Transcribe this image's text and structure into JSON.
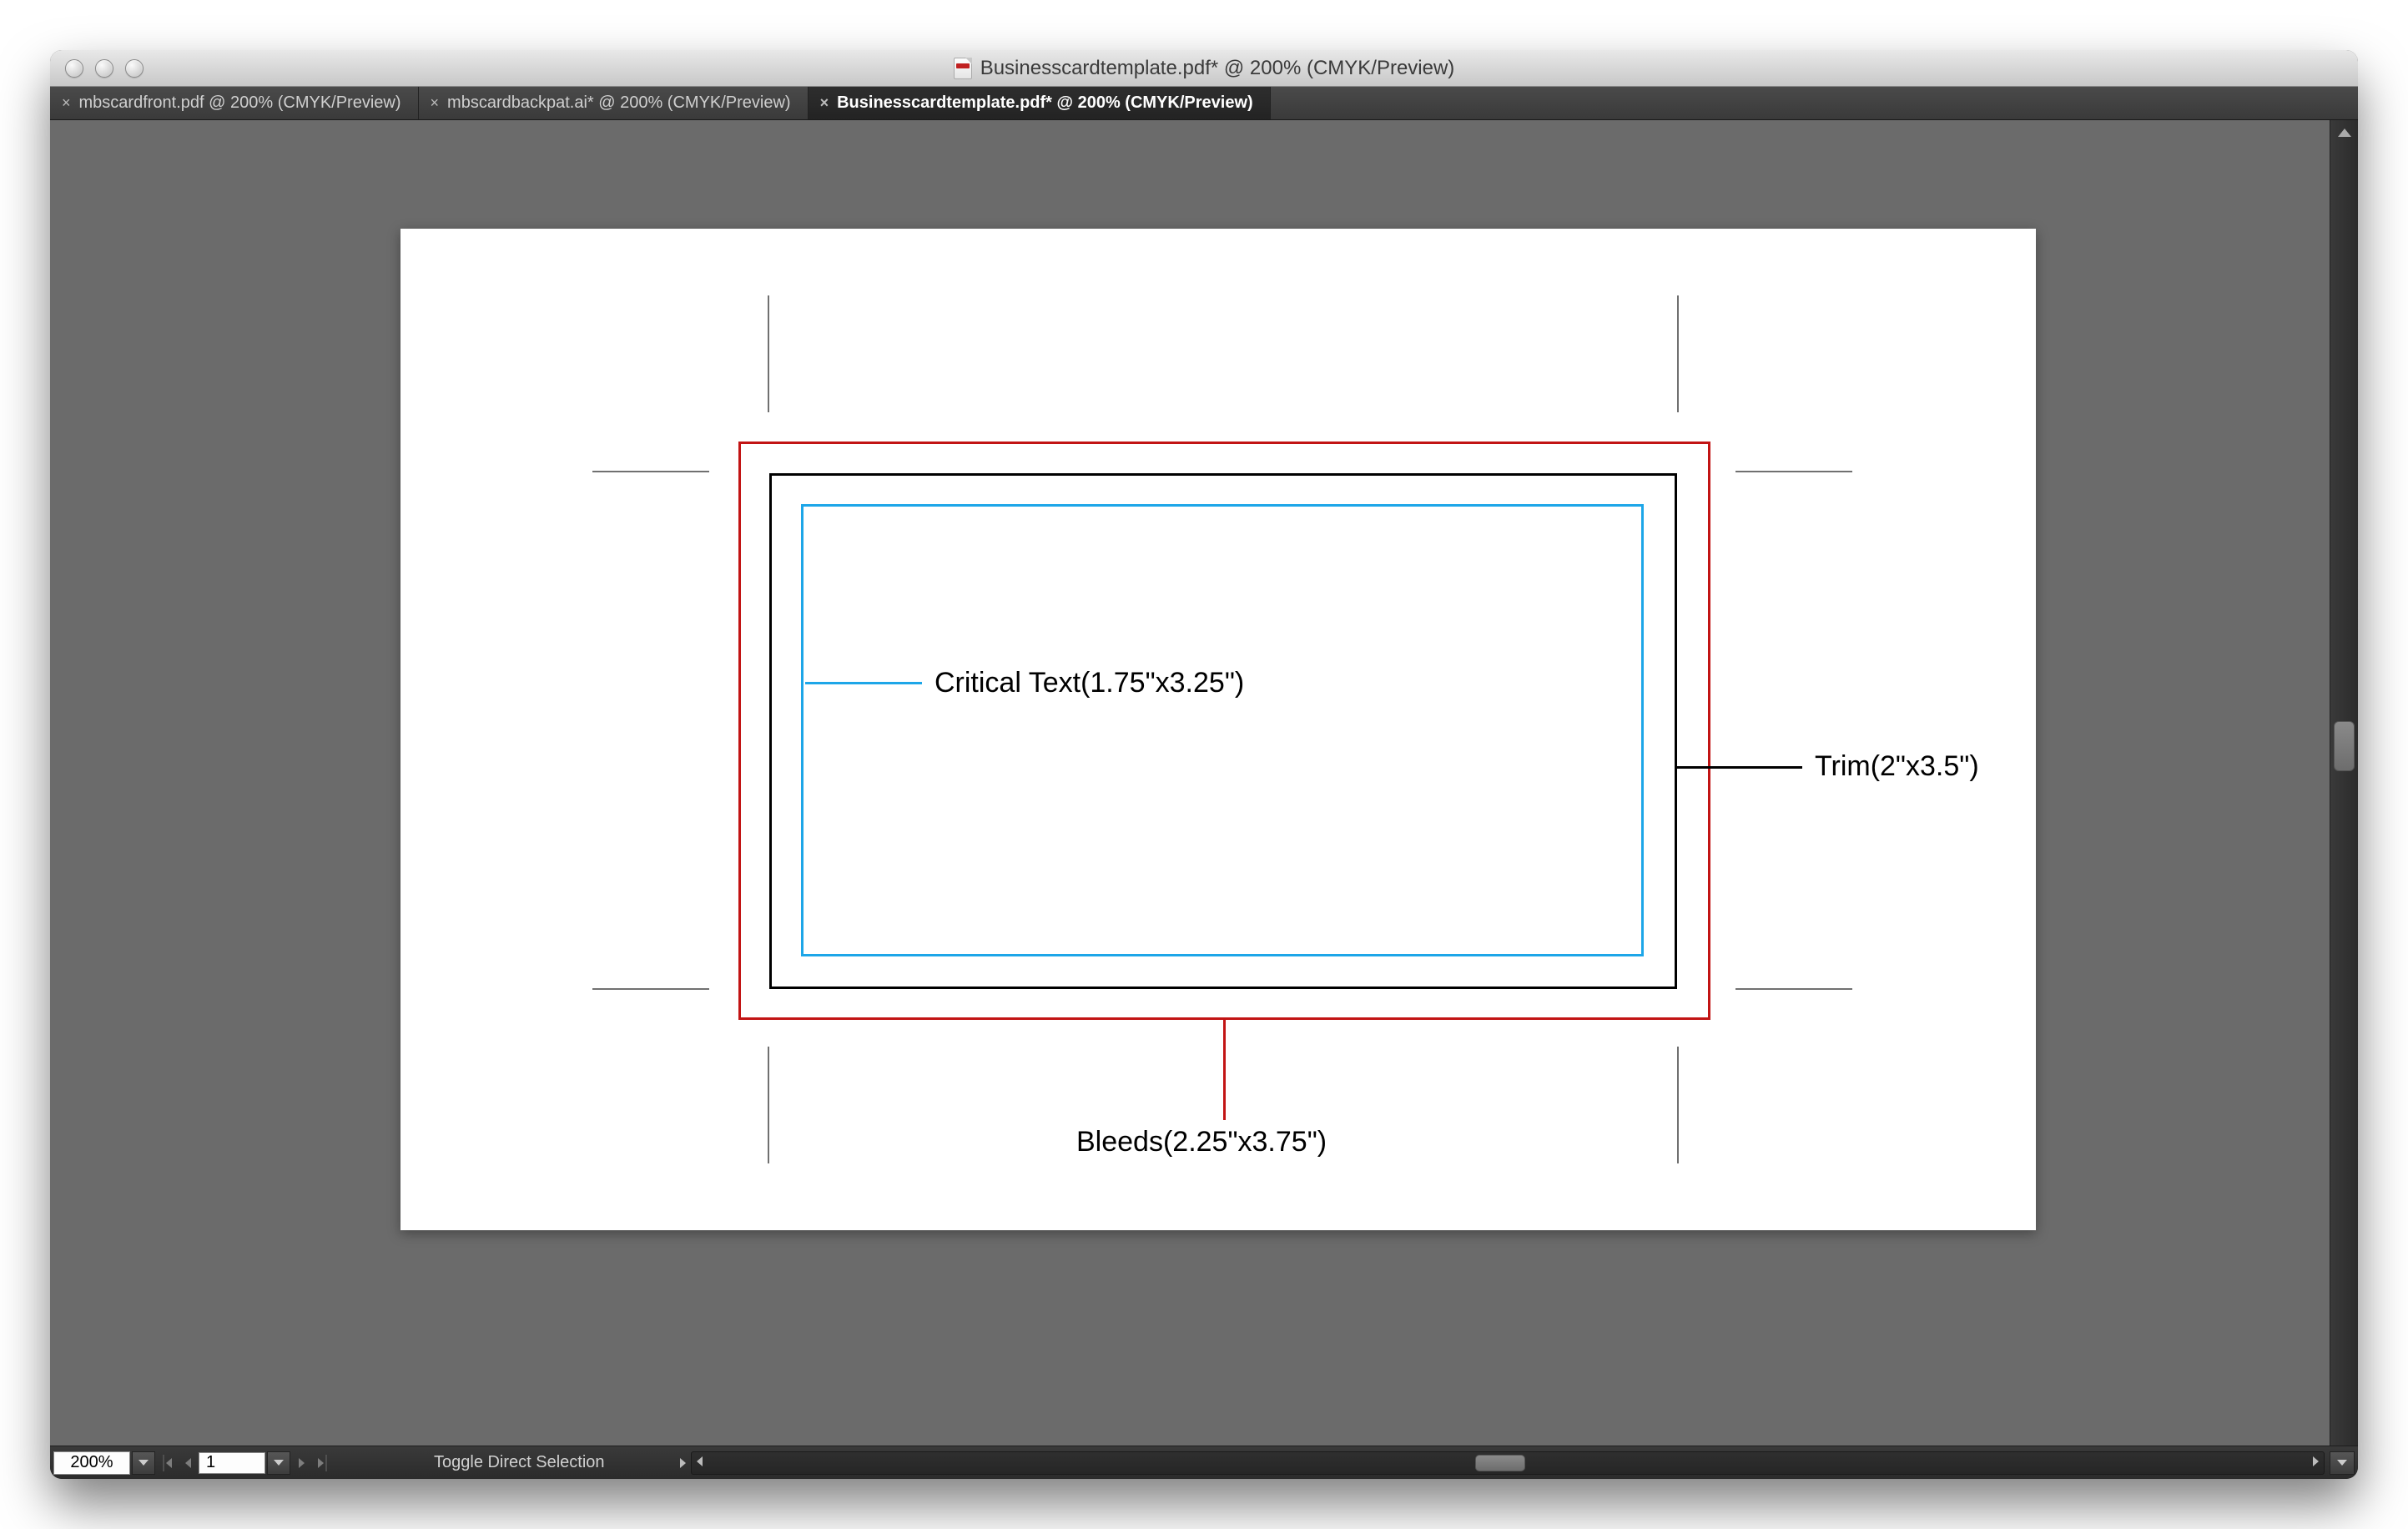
{
  "window": {
    "title": "Businesscardtemplate.pdf* @ 200% (CMYK/Preview)"
  },
  "tabs": [
    {
      "label": "mbscardfront.pdf @ 200% (CMYK/Preview)",
      "active": false
    },
    {
      "label": "mbscardbackpat.ai* @ 200% (CMYK/Preview)",
      "active": false
    },
    {
      "label": "Businesscardtemplate.pdf* @ 200% (CMYK/Preview)",
      "active": true
    }
  ],
  "artboard": {
    "labels": {
      "critical": "Critical Text(1.75\"x3.25\")",
      "trim": "Trim(2\"x3.5\")",
      "bleed": "Bleeds(2.25\"x3.75\")"
    },
    "colors": {
      "bleed": "#c21414",
      "trim": "#000000",
      "safe": "#1da6e8"
    }
  },
  "status": {
    "zoom": "200%",
    "artboard_number": "1",
    "hint": "Toggle Direct Selection"
  }
}
